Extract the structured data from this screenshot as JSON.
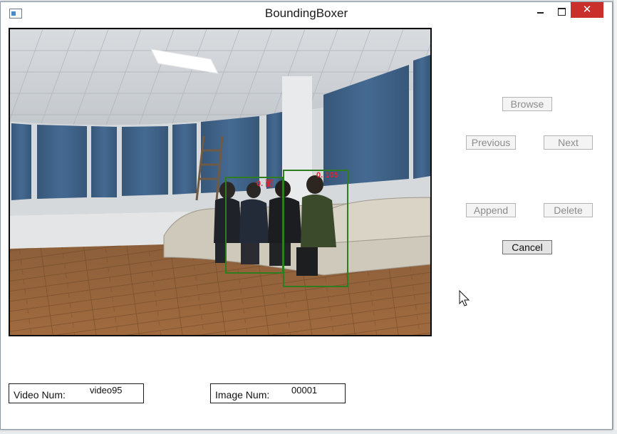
{
  "window": {
    "title": "BoundingBoxer",
    "close_glyph": "✕"
  },
  "viewer": {
    "boxes": [
      {
        "label": "0. 而"
      },
      {
        "label": "0. 105"
      }
    ]
  },
  "buttons": {
    "browse": "Browse",
    "previous": "Previous",
    "next": "Next",
    "append": "Append",
    "delete": "Delete",
    "cancel": "Cancel"
  },
  "fields": {
    "video_num_label": "Video Num:",
    "video_num_value": "video95",
    "image_num_label": "Image Num:",
    "image_num_value": "00001"
  },
  "colors": {
    "bbox": "#2e7d1e",
    "bbox_label": "#e3242b",
    "close_button": "#c9302c",
    "curtain": "#3f5f86"
  },
  "icons": [
    "app-window-icon",
    "minimize-icon",
    "maximize-icon",
    "close-icon",
    "mouse-pointer-icon"
  ]
}
